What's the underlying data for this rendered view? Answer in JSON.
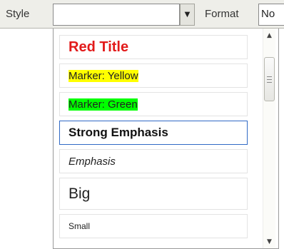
{
  "toolbar": {
    "style_label": "Style",
    "style_value": "",
    "format_label": "Format",
    "format_value": "No"
  },
  "dropdown": {
    "items": [
      {
        "label": "Red Title",
        "color": "#e21a1a"
      },
      {
        "label": "Marker: Yellow",
        "highlight": "#ffff00"
      },
      {
        "label": "Marker: Green",
        "highlight": "#00ff00"
      },
      {
        "label": "Strong Emphasis",
        "selected": true
      },
      {
        "label": "Emphasis"
      },
      {
        "label": "Big"
      },
      {
        "label": "Small"
      }
    ]
  },
  "icons": {
    "combo_arrow": "chevron-down-icon",
    "scroll_up": "chevron-up-icon",
    "scroll_down": "chevron-down-icon"
  }
}
